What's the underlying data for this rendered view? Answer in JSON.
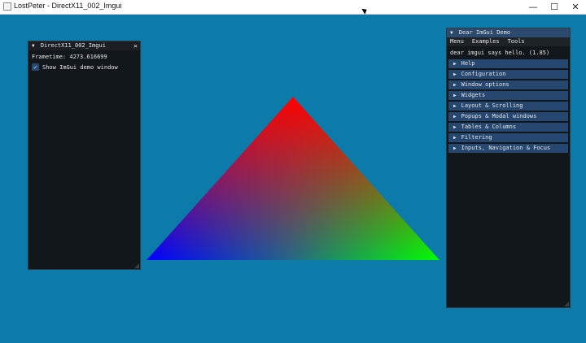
{
  "window": {
    "title": "LostPeter - DirectX11_002_Imgui",
    "minimize_glyph": "—",
    "maximize_glyph": "☐",
    "close_glyph": "✕"
  },
  "colors": {
    "background": "#0d7ba9",
    "triangle_top": "#ff0000",
    "triangle_left": "#0000ff",
    "triangle_right": "#00ff00",
    "imgui_window_bg": "#11171b",
    "imgui_header_bg": "#26476f"
  },
  "small_window": {
    "title": "DirectX11_002_Imgui",
    "frametime": "Frametime: 4273.616699",
    "checkbox_label": "Show ImGui demo window",
    "checkbox_checked": true
  },
  "demo_window": {
    "title": "Dear ImGui Demo",
    "menu": [
      "Menu",
      "Examples",
      "Tools"
    ],
    "hello": "dear imgui says hello. (1.85)",
    "headers": [
      "Help",
      "Configuration",
      "Window options",
      "Widgets",
      "Layout & Scrolling",
      "Popups & Modal windows",
      "Tables & Columns",
      "Filtering",
      "Inputs, Navigation & Focus"
    ]
  }
}
